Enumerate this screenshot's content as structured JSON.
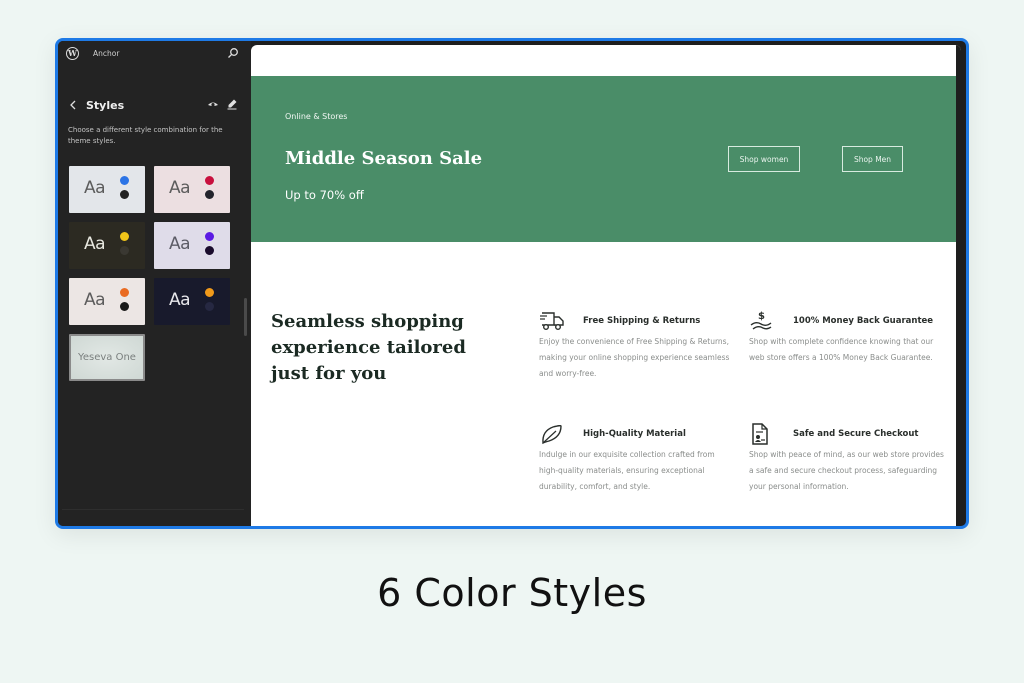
{
  "editor": {
    "site_name": "Anchor",
    "panel": {
      "title": "Styles",
      "description": "Choose a different style combination for the theme styles.",
      "icons": {
        "logo": "wordpress-icon",
        "search": "search-icon",
        "back": "chevron-left-icon",
        "preview": "eye-icon",
        "edit": "pencil-icon"
      },
      "variations": [
        {
          "label": "Aa",
          "bg": "#e3e6ea",
          "text": "#5c5c5c",
          "accent": "#2b74e6",
          "contrast": "#222222"
        },
        {
          "label": "Aa",
          "bg": "#ecdfe1",
          "text": "#5c5c5c",
          "accent": "#c8103e",
          "contrast": "#23242c"
        },
        {
          "label": "Aa",
          "bg": "#2c2a22",
          "text": "#e8e8e0",
          "accent": "#f0c419",
          "contrast": "#3a3832"
        },
        {
          "label": "Aa",
          "bg": "#dfdce9",
          "text": "#5c5c66",
          "accent": "#5b1be3",
          "contrast": "#1a0c2c"
        },
        {
          "label": "Aa",
          "bg": "#ece6e4",
          "text": "#5c5c5c",
          "accent": "#e96b22",
          "contrast": "#1a1a1a"
        },
        {
          "label": "Aa",
          "bg": "#181a2c",
          "text": "#e8e8ec",
          "accent": "#f19a1a",
          "contrast": "#262842"
        }
      ],
      "font_variation": {
        "label": "Yeseva One",
        "bg": "#cfd8d4"
      }
    }
  },
  "preview": {
    "hero": {
      "eyebrow": "Online & Stores",
      "title": "Middle Season Sale",
      "subtitle": "Up to 70% off",
      "buttons": [
        "Shop women",
        "Shop Men"
      ],
      "bg": "#4a8d68"
    },
    "features": {
      "heading": "Seamless shopping experience tailored just for you",
      "items": [
        {
          "icon": "truck-icon",
          "title": "Free Shipping & Returns",
          "desc": "Enjoy the convenience of Free Shipping & Returns, making your online shopping experience seamless and worry-free."
        },
        {
          "icon": "money-back-icon",
          "title": "100% Money Back Guarantee",
          "desc": "Shop with complete confidence knowing that our web store offers a 100% Money Back Guarantee."
        },
        {
          "icon": "leaf-icon",
          "title": "High-Quality Material",
          "desc": "Indulge in our exquisite collection crafted from high-quality materials, ensuring exceptional durability, comfort, and style."
        },
        {
          "icon": "secure-document-icon",
          "title": "Safe and Secure Checkout",
          "desc": "Shop with peace of mind, as our web store provides a safe and secure checkout process, safeguarding your personal information."
        }
      ]
    }
  },
  "caption": "6 Color Styles"
}
